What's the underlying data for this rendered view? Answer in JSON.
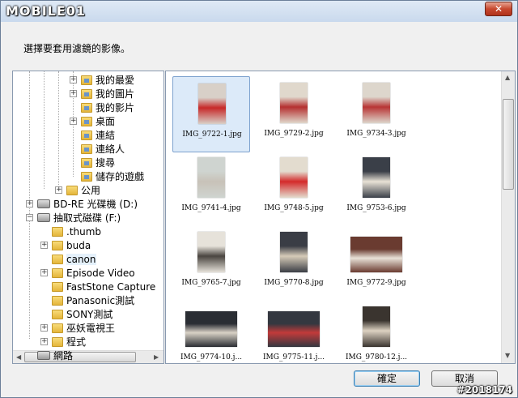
{
  "window": {
    "logo": "MOBILE01",
    "close_label": "✕"
  },
  "prompt": "選擇要套用濾鏡的影像。",
  "tree": [
    {
      "label": "我的最愛",
      "indent": 3,
      "expander": "+",
      "icon": "favorites-folder-icon",
      "special": true
    },
    {
      "label": "我的圖片",
      "indent": 3,
      "expander": "+",
      "icon": "pictures-folder-icon",
      "special": true
    },
    {
      "label": "我的影片",
      "indent": 3,
      "expander": "",
      "icon": "videos-folder-icon",
      "special": true
    },
    {
      "label": "桌面",
      "indent": 3,
      "expander": "+",
      "icon": "desktop-folder-icon",
      "special": true
    },
    {
      "label": "連結",
      "indent": 3,
      "expander": "",
      "icon": "links-folder-icon",
      "special": true
    },
    {
      "label": "連絡人",
      "indent": 3,
      "expander": "",
      "icon": "contacts-folder-icon",
      "special": true
    },
    {
      "label": "搜尋",
      "indent": 3,
      "expander": "",
      "icon": "searches-folder-icon",
      "special": true
    },
    {
      "label": "儲存的遊戲",
      "indent": 3,
      "expander": "",
      "icon": "saved-games-folder-icon",
      "special": true
    },
    {
      "label": "公用",
      "indent": 2,
      "expander": "+",
      "icon": "public-folder-icon",
      "special": false
    },
    {
      "label": "BD-RE 光碟機 (D:)",
      "indent": 0,
      "expander": "+",
      "icon": "optical-drive-icon",
      "drive": true
    },
    {
      "label": "抽取式磁碟 (F:)",
      "indent": 0,
      "expander": "-",
      "icon": "removable-drive-icon",
      "drive": true
    },
    {
      "label": ".thumb",
      "indent": 1,
      "expander": "",
      "icon": "folder-icon",
      "special": false
    },
    {
      "label": "buda",
      "indent": 1,
      "expander": "+",
      "icon": "folder-icon",
      "special": false
    },
    {
      "label": "canon",
      "indent": 1,
      "expander": "",
      "icon": "folder-icon",
      "special": false,
      "selected": true
    },
    {
      "label": "Episode Video",
      "indent": 1,
      "expander": "+",
      "icon": "folder-icon",
      "special": false
    },
    {
      "label": "FastStone Capture",
      "indent": 1,
      "expander": "",
      "icon": "folder-icon",
      "special": false
    },
    {
      "label": "Panasonic測試",
      "indent": 1,
      "expander": "",
      "icon": "folder-icon",
      "special": false
    },
    {
      "label": "SONY測試",
      "indent": 1,
      "expander": "",
      "icon": "folder-icon",
      "special": false
    },
    {
      "label": "巫妖電視王",
      "indent": 1,
      "expander": "+",
      "icon": "folder-icon",
      "special": false
    },
    {
      "label": "程式",
      "indent": 1,
      "expander": "+",
      "icon": "folder-icon",
      "special": false
    },
    {
      "label": "網路",
      "indent": 0,
      "expander": "",
      "icon": "network-icon",
      "drive": true
    }
  ],
  "thumbnails": [
    {
      "name": "IMG_9722-1.jpg",
      "orient": "portrait",
      "colors": [
        "#d8d0c8",
        "#c72929"
      ],
      "selected": true
    },
    {
      "name": "IMG_9729-2.jpg",
      "orient": "portrait",
      "colors": [
        "#e0d8cc",
        "#b53030"
      ]
    },
    {
      "name": "IMG_9734-3.jpg",
      "orient": "portrait",
      "colors": [
        "#ddd6cc",
        "#b83535"
      ]
    },
    {
      "name": "IMG_9741-4.jpg",
      "orient": "portrait",
      "colors": [
        "#cfd4d0",
        "#c8c2b8"
      ]
    },
    {
      "name": "IMG_9748-5.jpg",
      "orient": "portrait",
      "colors": [
        "#e3dccf",
        "#d42a2a"
      ]
    },
    {
      "name": "IMG_9753-6.jpg",
      "orient": "portrait",
      "colors": [
        "#3a3f48",
        "#e8e2d6"
      ]
    },
    {
      "name": "IMG_9765-7.jpg",
      "orient": "portrait",
      "colors": [
        "#e6e2da",
        "#4a4540"
      ]
    },
    {
      "name": "IMG_9770-8.jpg",
      "orient": "portrait",
      "colors": [
        "#3a3d45",
        "#d6cbb8"
      ]
    },
    {
      "name": "IMG_9772-9.jpg",
      "orient": "landscape",
      "colors": [
        "#6a3b30",
        "#e8e2d8"
      ]
    },
    {
      "name": "IMG_9774-10.j...",
      "orient": "landscape",
      "colors": [
        "#2a2d33",
        "#d9d2c6"
      ]
    },
    {
      "name": "IMG_9775-11.j...",
      "orient": "landscape",
      "colors": [
        "#343840",
        "#c23a3a"
      ]
    },
    {
      "name": "IMG_9780-12.j...",
      "orient": "portrait",
      "colors": [
        "#3a342f",
        "#ddd2c2"
      ]
    }
  ],
  "buttons": {
    "ok": "確定",
    "cancel": "取消"
  },
  "watermark": "#2018174"
}
